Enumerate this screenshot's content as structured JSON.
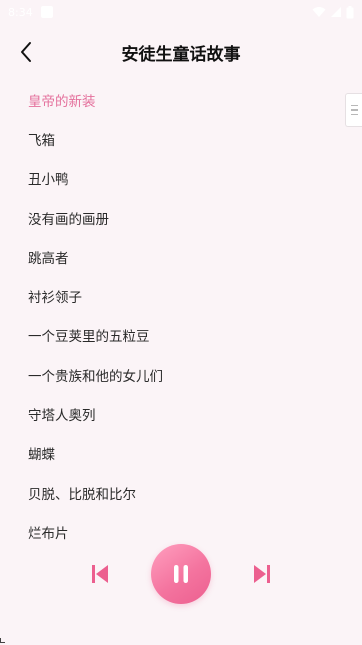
{
  "status_bar": {
    "time": "8:34"
  },
  "header": {
    "title": "安徒生童话故事"
  },
  "stories": [
    {
      "label": "皇帝的新装",
      "active": true
    },
    {
      "label": "飞箱"
    },
    {
      "label": "丑小鸭"
    },
    {
      "label": "没有画的画册"
    },
    {
      "label": "跳高者"
    },
    {
      "label": "衬衫领子"
    },
    {
      "label": "一个豆荚里的五粒豆"
    },
    {
      "label": "一个贵族和他的女儿们"
    },
    {
      "label": "守塔人奥列"
    },
    {
      "label": "蝴蝶"
    },
    {
      "label": "贝脱、比脱和比尔"
    },
    {
      "label": "烂布片"
    }
  ],
  "colors": {
    "accent": "#e4709c",
    "background": "#fbf4f7",
    "control": "#ec5f8f"
  },
  "icons": {
    "back": "chevron-left-icon",
    "prev": "skip-previous-icon",
    "play_state": "pause-icon",
    "next": "skip-next-icon"
  }
}
